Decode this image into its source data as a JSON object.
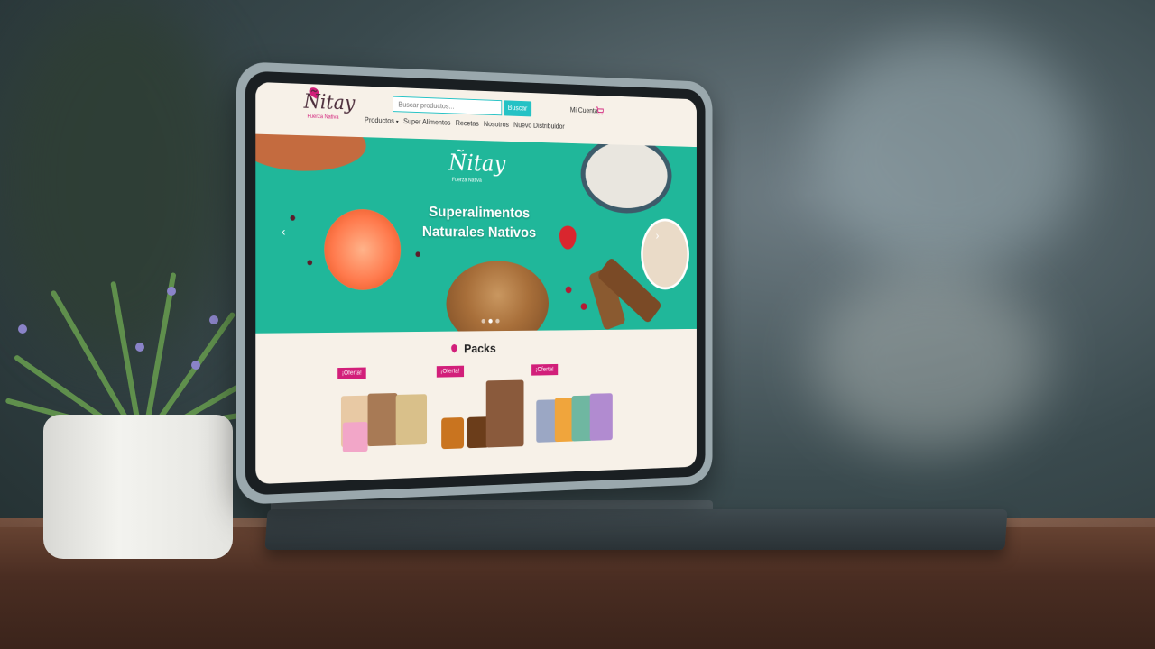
{
  "site": {
    "logo_text": "Ñitay",
    "logo_tagline": "Fuerza Nativa",
    "search": {
      "placeholder": "Buscar productos...",
      "button": "Buscar"
    },
    "account_label": "Mi Cuenta",
    "nav": [
      "Productos",
      "Super Alimentos",
      "Recetas",
      "Nosotros",
      "Nuevo Distribuidor"
    ],
    "hero": {
      "logo_text": "Ñitay",
      "logo_tagline": "Fuerza Nativa",
      "title_line1": "Superalimentos",
      "title_line2": "Naturales Nativos"
    },
    "packs": {
      "title": "Packs",
      "products": [
        {
          "badge": "¡Oferta!"
        },
        {
          "badge": "¡Oferta!"
        },
        {
          "badge": "¡Oferta!"
        }
      ]
    }
  },
  "colors": {
    "accent": "#25c2c5",
    "brand": "#d21f7a",
    "hero_bg": "#20b79a"
  },
  "icons": [
    "cart-icon",
    "chevron-down-icon",
    "chevron-left-icon",
    "chevron-right-icon",
    "leaf-logo-icon"
  ]
}
